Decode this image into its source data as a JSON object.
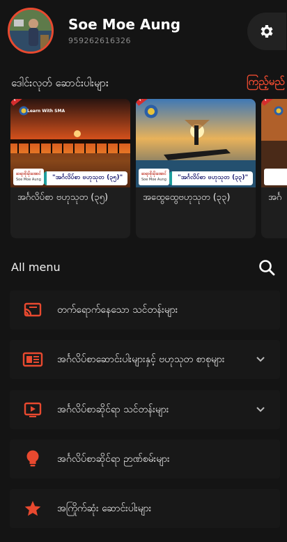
{
  "user": {
    "name": "Soe Moe Aung",
    "phone": "959262616326"
  },
  "featured": {
    "title": "ဒေါင်းလုတ် ဆောင်းပါးများ",
    "see_all": "ကြည့်မည်",
    "cards": [
      {
        "title": "အင်္ဂလိပ်စာ ဗဟုသုတ (၃၅)",
        "badge_label": "ဆရာစိုးမိုးအောင်",
        "badge_sub": "Soe Moe Aung",
        "pill_text": "\"အင်္ဂလိပ်စာ ဗဟုသုတ (၃၅)\"",
        "free": "FREE",
        "learn": "Learn With SMA"
      },
      {
        "title": "အထွေထွေဗဟုသုတ (၃၃)",
        "badge_label": "ဆရာစိုးမိုးအောင်",
        "badge_sub": "Soe Moe Aung",
        "pill_text": "\"အင်္ဂလိပ်စာ ဗဟုသုတ (၃၃)\"",
        "free": "FREE"
      },
      {
        "title": "အင်္ဂ",
        "free": "FREE"
      }
    ]
  },
  "menu": {
    "heading": "All menu",
    "items": [
      {
        "label": "တက်ရောက်နေသော သင်တန်းများ",
        "icon": "cast-icon",
        "expandable": false
      },
      {
        "label": "အင်္ဂလိပ်စာဆောင်းပါးများနှင့် ဗဟုသုတ စာစုများ",
        "icon": "newspaper-icon",
        "expandable": true
      },
      {
        "label": "အင်္ဂလိပ်စာဆိုင်ရာ သင်တန်းများ",
        "icon": "video-icon",
        "expandable": true
      },
      {
        "label": "အင်္ဂလိပ်စာဆိုင်ရာ ဉာဏ်စမ်းများ",
        "icon": "lightbulb-icon",
        "expandable": false
      },
      {
        "label": "အကြိုက်ဆုံး ဆောင်းပါးများ",
        "icon": "star-icon",
        "expandable": false
      }
    ]
  },
  "colors": {
    "accent": "#e8492f",
    "background": "#141414",
    "card": "#1e1e1e"
  }
}
